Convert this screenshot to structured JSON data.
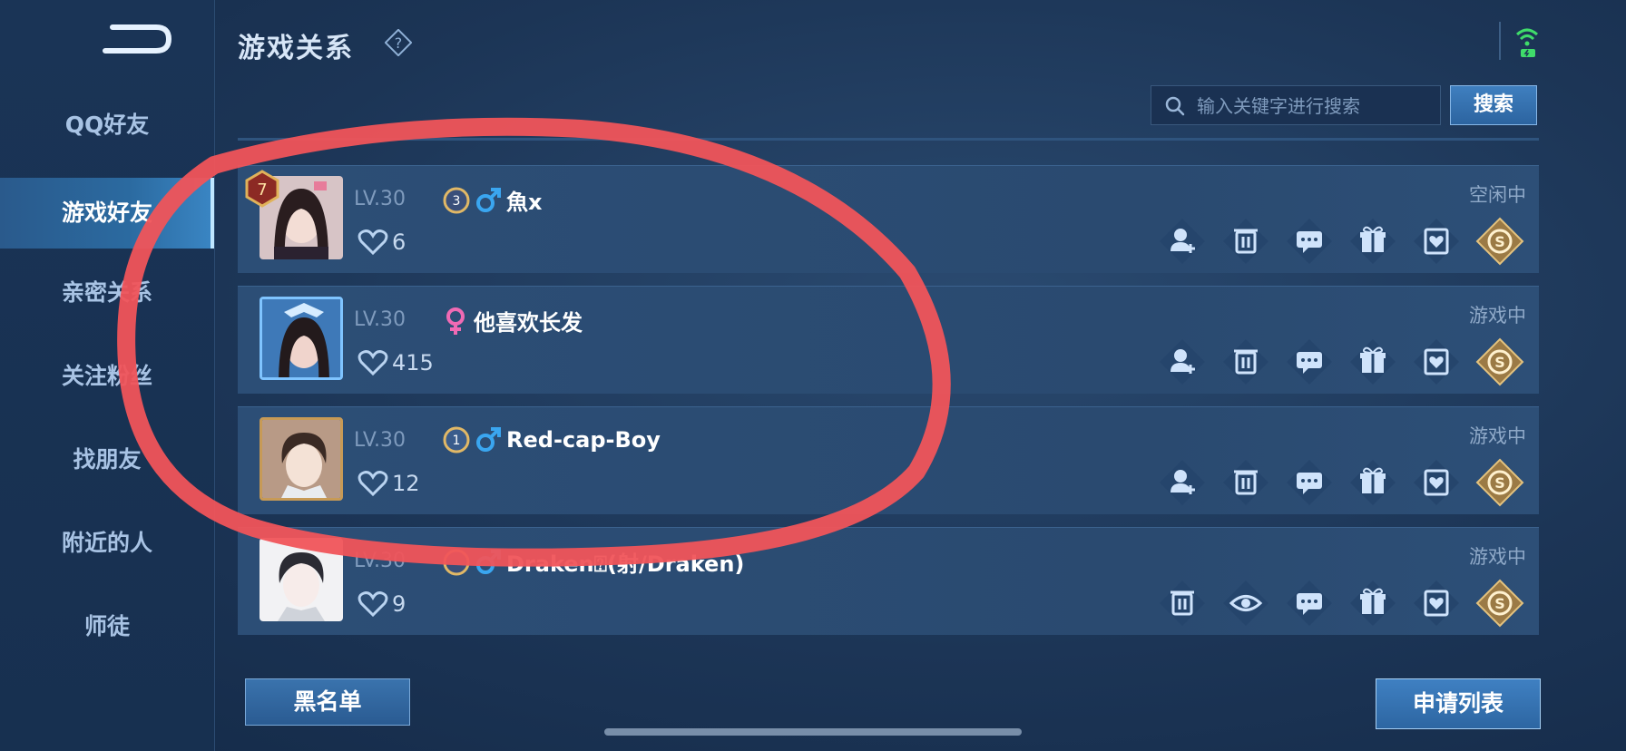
{
  "header": {
    "title": "游戏关系"
  },
  "sidebar": {
    "items": [
      {
        "label": "QQ好友",
        "active": false
      },
      {
        "label": "游戏好友",
        "active": true
      },
      {
        "label": "亲密关系",
        "active": false
      },
      {
        "label": "关注粉丝",
        "active": false
      },
      {
        "label": "找朋友",
        "active": false
      },
      {
        "label": "附近的人",
        "active": false
      },
      {
        "label": "师徒",
        "active": false
      }
    ]
  },
  "search": {
    "placeholder": "输入关键字进行搜索",
    "button_label": "搜索"
  },
  "friends": [
    {
      "rank": "7",
      "level": "LV.30",
      "tier": "3",
      "gender": "male",
      "name": "魚x",
      "likes": "6",
      "status": "空闲中"
    },
    {
      "rank": "",
      "level": "LV.30",
      "tier": "",
      "gender": "female",
      "name": "他喜欢长发",
      "likes": "415",
      "status": "游戏中"
    },
    {
      "rank": "",
      "level": "LV.30",
      "tier": "1",
      "gender": "male",
      "name": "Red-cap-Boy",
      "likes": "12",
      "status": "游戏中"
    },
    {
      "rank": "",
      "level": "LV.30",
      "tier": "",
      "gender": "male",
      "name": "Draken⍰(射/Draken)",
      "likes": "9",
      "status": "游戏中"
    }
  ],
  "footer": {
    "blacklist_label": "黑名单",
    "apply_list_label": "申请列表"
  },
  "colors": {
    "annotation": "#f0545a",
    "accent": "#2c64a0",
    "gold": "#c9a15a"
  }
}
